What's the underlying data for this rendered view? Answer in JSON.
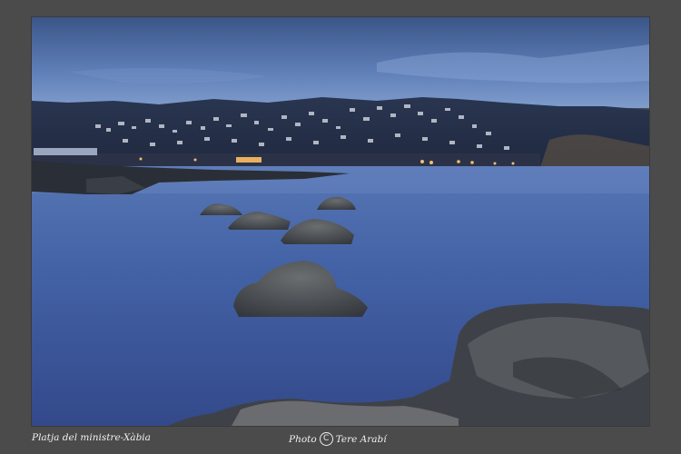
{
  "photo": {
    "description_colors": {
      "sky_top": "#3d5a8f",
      "sky_bottom": "#6f8fc4",
      "sea": "#3f5a9c",
      "hills": "#26314a",
      "rocks": "#4a4e54"
    }
  },
  "caption": {
    "location": "Platja del ministre-Xàbia",
    "photo_prefix": "Photo",
    "copyright_symbol": "C",
    "author": "Tere Arabí"
  }
}
